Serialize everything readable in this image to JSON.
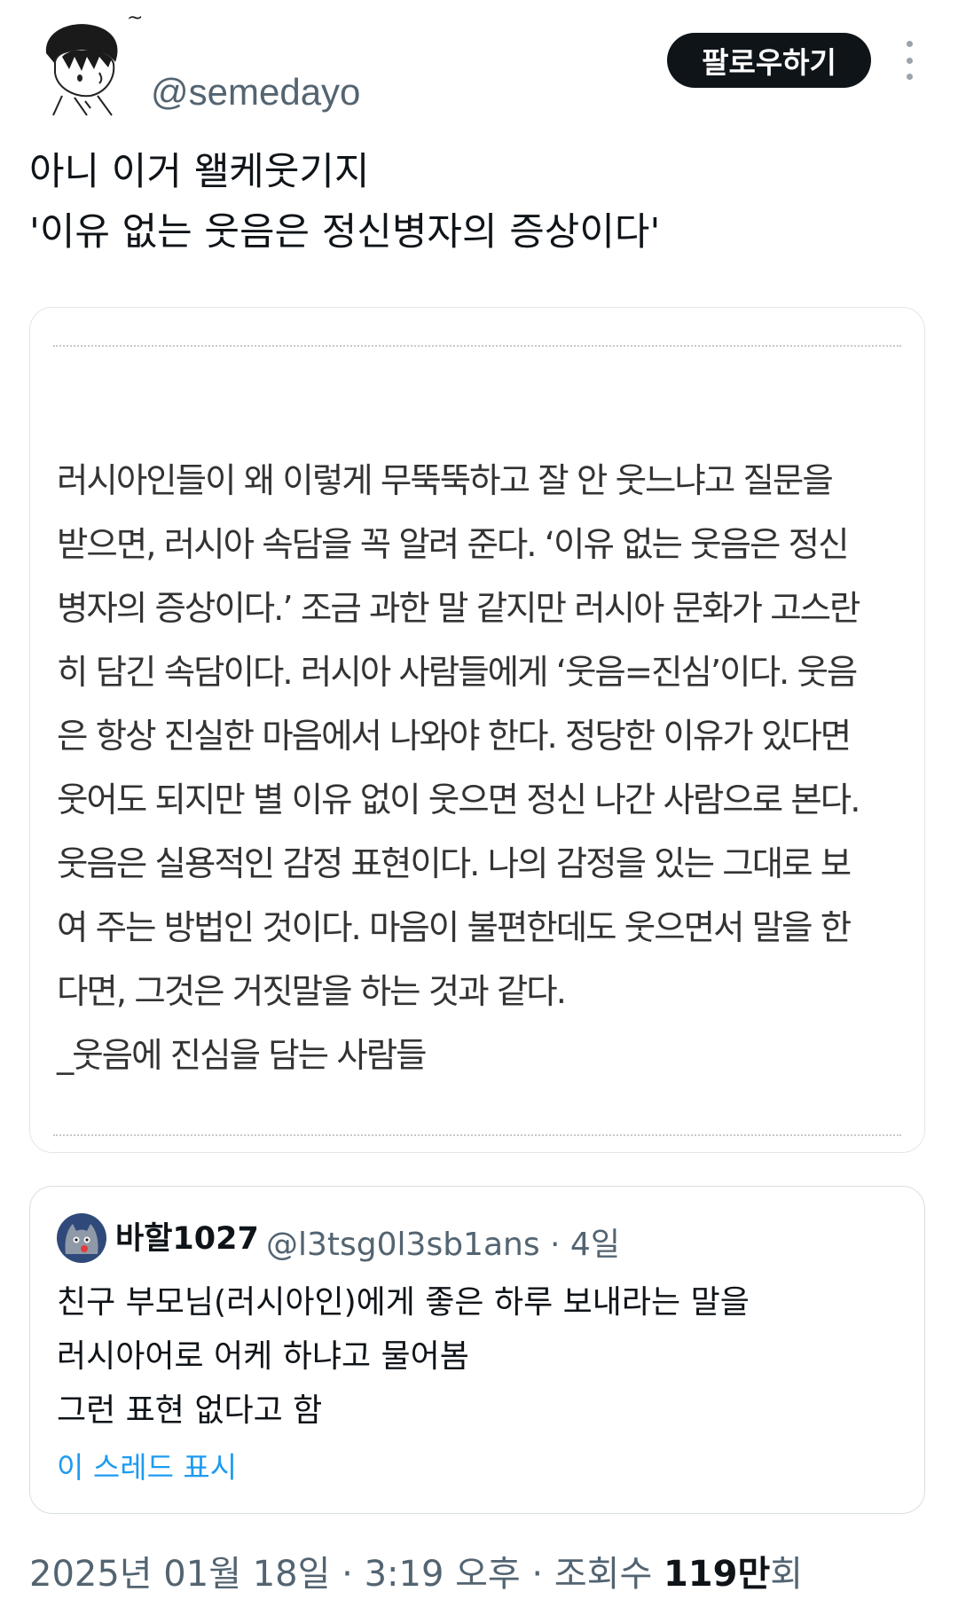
{
  "author": {
    "name_mark": "~",
    "handle": "@semedayo",
    "avatar_icon": "cartoon-boy-avatar"
  },
  "actions": {
    "follow_label": "팔로우하기",
    "more_icon": "more-vertical-icon"
  },
  "tweet": {
    "text": "아니 이거 왤케웃기지\n'이유 없는 웃음은 정신병자의 증상이다'"
  },
  "image": {
    "excerpt": "러시아인들이 왜 이렇게 무뚝뚝하고 잘 안 웃느냐고 질문을\n받으면, 러시아 속담을 꼭 알려 준다. ‘이유 없는 웃음은 정신\n병자의 증상이다.’ 조금 과한 말 같지만 러시아 문화가 고스란\n히 담긴 속담이다. 러시아 사람들에게 ‘웃음=진심’이다. 웃음\n은 항상 진실한 마음에서 나와야 한다. 정당한 이유가 있다면\n웃어도 되지만 별 이유 없이 웃으면 정신 나간 사람으로 본다.\n웃음은 실용적인 감정 표현이다. 나의 감정을 있는 그대로 보\n여 주는 방법인 것이다. 마음이 불편한데도 웃으면서 말을 한\n다면, 그것은 거짓말을 하는 것과 같다.\n_웃음에 진심을 담는 사람들"
  },
  "quote": {
    "avatar_icon": "cat-avatar",
    "name": "바할1027",
    "meta": "@l3tsg0l3sb1ans · 4일",
    "text": "친구 부모님(러시아인)에게 좋은 하루 보내라는 말을\n러시아어로 어케 하냐고 물어봄\n그런 표현 없다고 함",
    "thread_link": "이 스레드 표시"
  },
  "footer": {
    "datetime": "2025년 01월 18일 · 3:19 오후 · 조회수 ",
    "views_number": "119만",
    "views_suffix": "회"
  },
  "colors": {
    "text": "#0f1419",
    "secondary": "#536471",
    "link": "#1d9bf0",
    "button_bg": "#0f1419"
  }
}
